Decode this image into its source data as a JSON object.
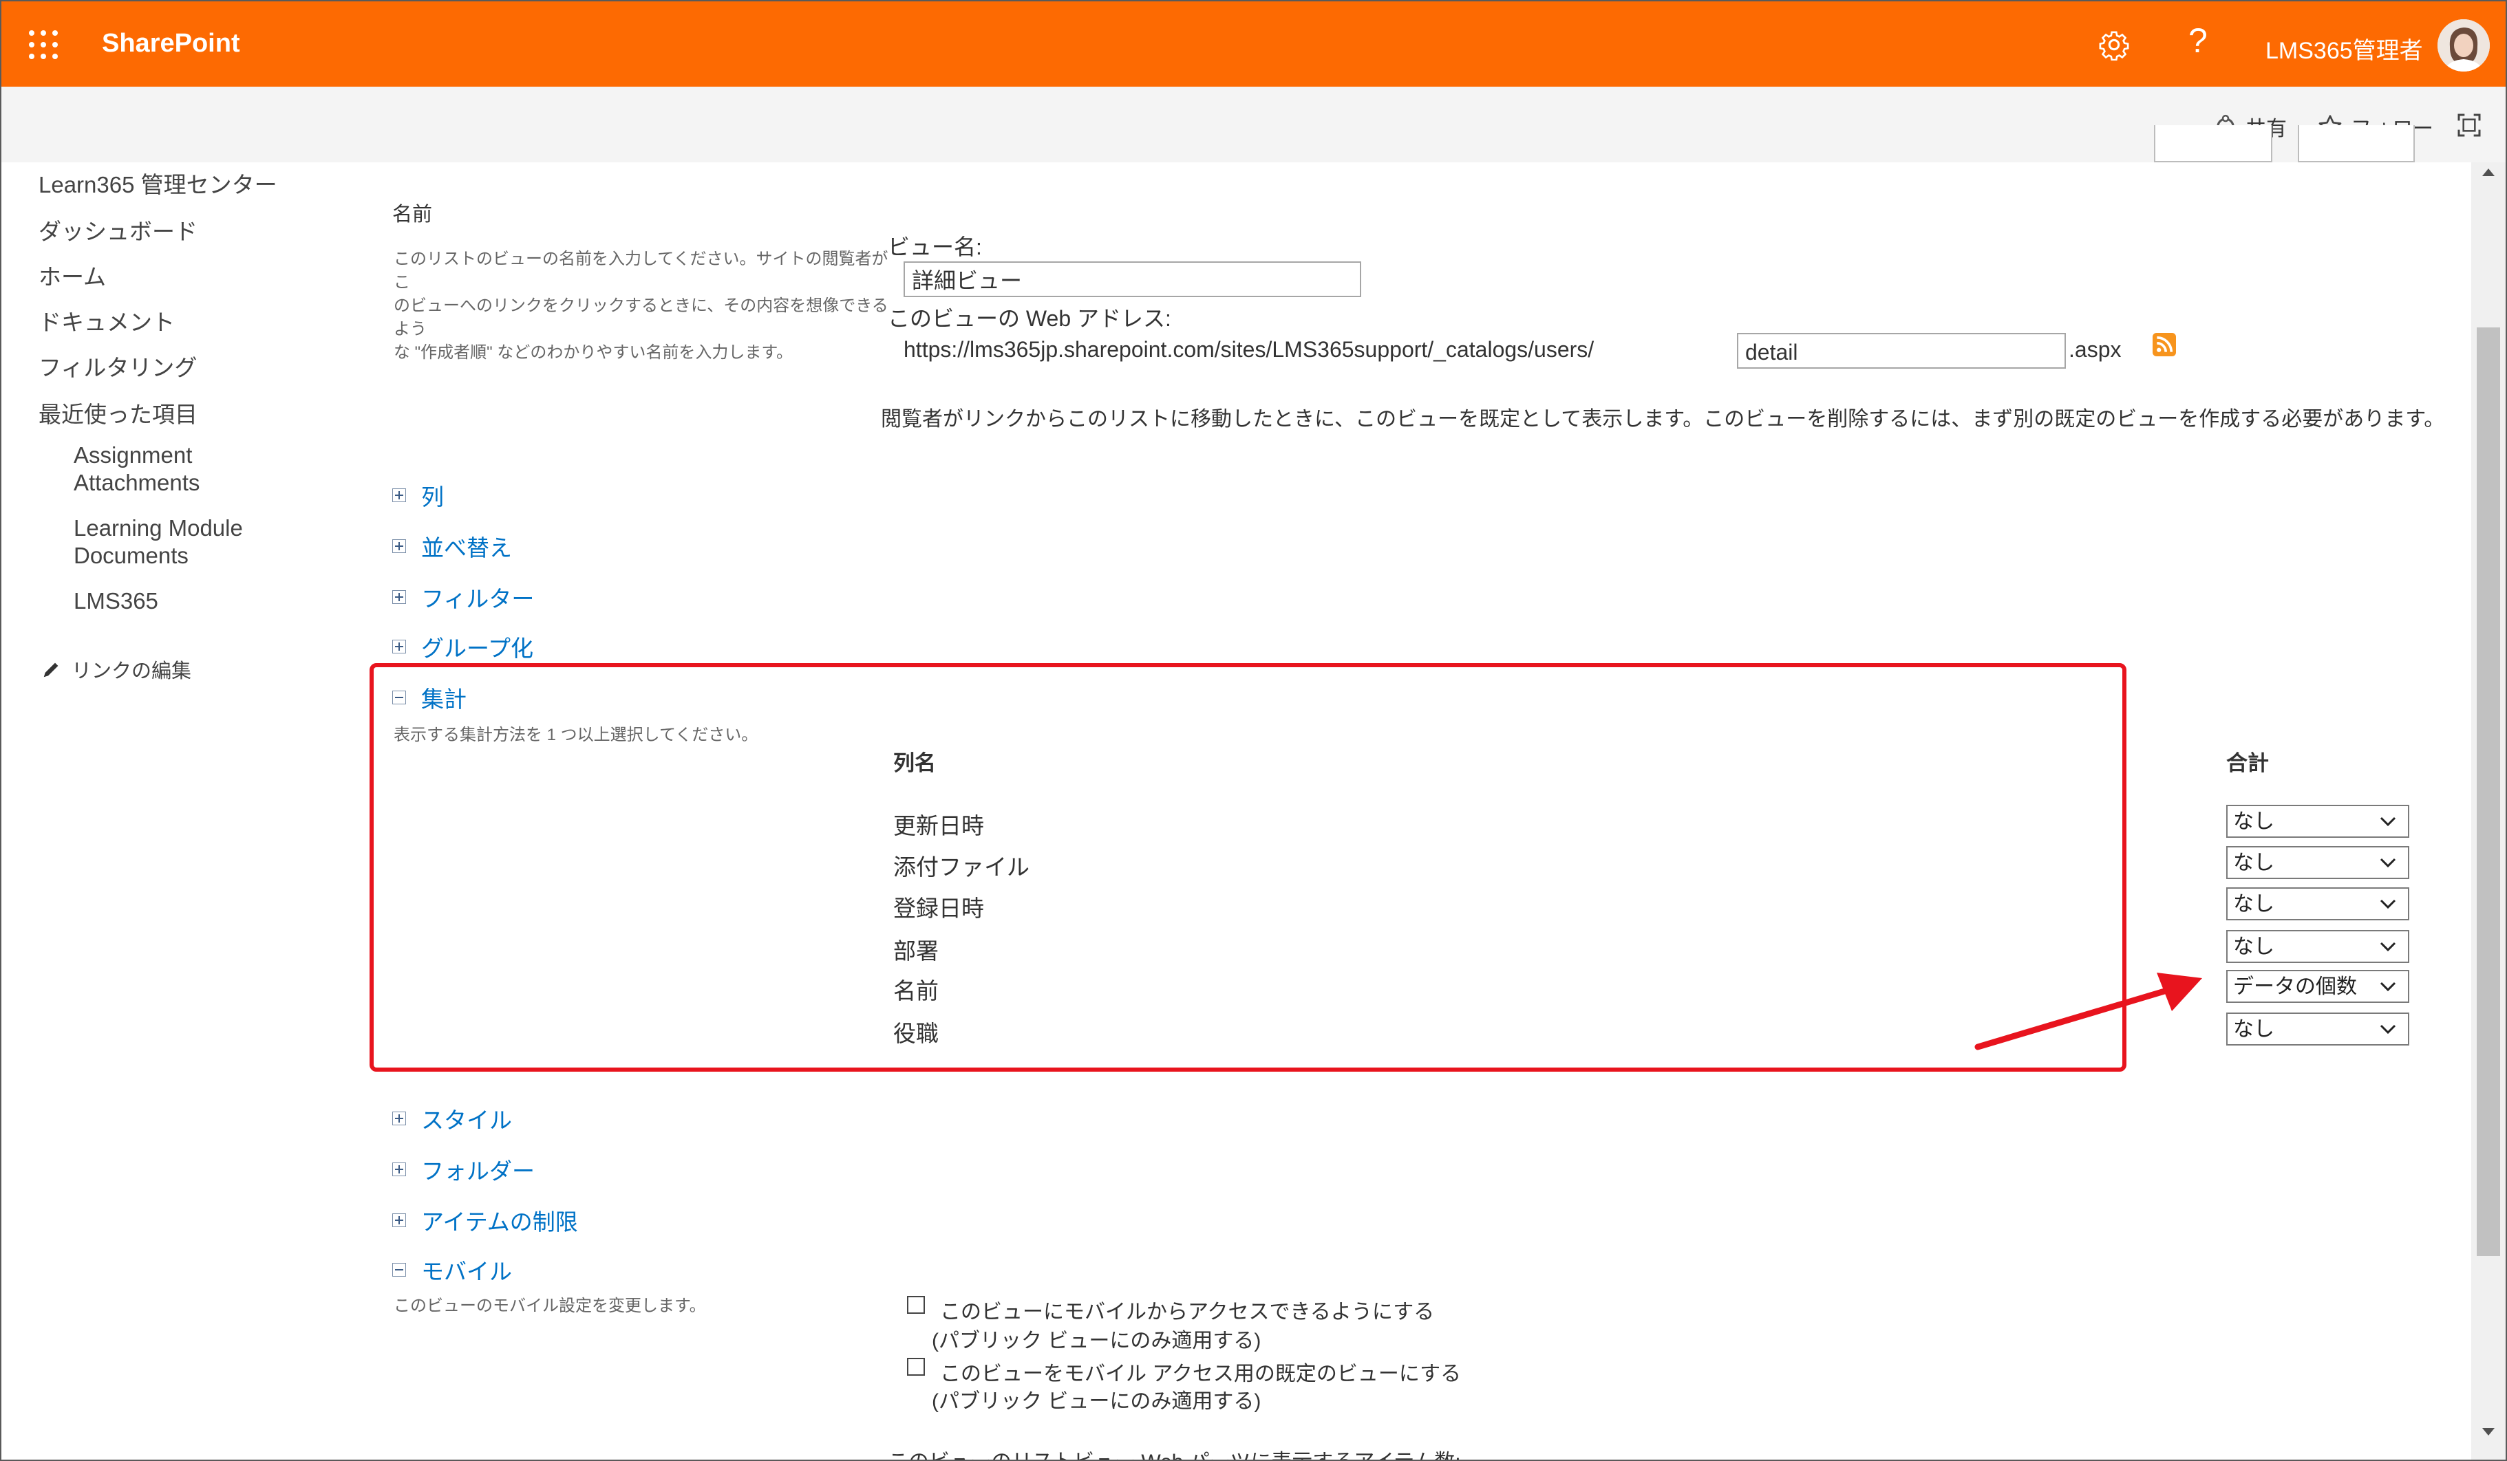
{
  "suite": {
    "brand": "SharePoint",
    "help": "?",
    "user_name": "LMS365管理者"
  },
  "commands": {
    "share": "共有",
    "follow": "フォロー"
  },
  "nav": {
    "title": "Learn365 管理センター",
    "items": [
      "ダッシュボード",
      "ホーム",
      "ドキュメント",
      "フィルタリング",
      "最近使った項目"
    ],
    "recent": [
      {
        "line1": "Assignment",
        "line2": "Attachments"
      },
      {
        "line1": "Learning Module",
        "line2": "Documents"
      },
      {
        "line1": "LMS365",
        "line2": ""
      }
    ],
    "edit_links": "リンクの編集"
  },
  "name_section": {
    "heading": "名前",
    "desc_lines": [
      "このリストのビューの名前を入力してください。サイトの閲覧者がこ",
      "のビューへのリンクをクリックするときに、その内容を想像できるよう",
      "な \"作成者順\" などのわかりやすい名前を入力します。"
    ],
    "view_name_label": "ビュー名:",
    "view_name_value": "詳細ビュー",
    "web_address_label": "このビューの Web アドレス:",
    "url_prefix": "https://lms365jp.sharepoint.com/sites/LMS365support/_catalogs/users/",
    "url_value": "detail",
    "url_suffix": ".aspx",
    "default_note": "閲覧者がリンクからこのリストに移動したときに、このビューを既定として表示します。このビューを削除するには、まず別の既定のビューを作成する必要があります。"
  },
  "sections": {
    "columns": "列",
    "sort": "並べ替え",
    "filter": "フィルター",
    "group": "グループ化",
    "totals": "集計",
    "style": "スタイル",
    "folders": "フォルダー",
    "limit": "アイテムの制限",
    "mobile": "モバイル"
  },
  "totals": {
    "desc": "表示する集計方法を 1 つ以上選択してください。",
    "col_header": "列名",
    "total_header": "合計",
    "rows": [
      {
        "name": "更新日時",
        "value": "なし"
      },
      {
        "name": "添付ファイル",
        "value": "なし"
      },
      {
        "name": "登録日時",
        "value": "なし"
      },
      {
        "name": "部署",
        "value": "なし"
      },
      {
        "name": "名前",
        "value": "データの個数"
      },
      {
        "name": "役職",
        "value": "なし"
      }
    ]
  },
  "mobile": {
    "desc": "このビューのモバイル設定を変更します。",
    "option1": "このビューにモバイルからアクセスできるようにする",
    "option1_note": "(パブリック ビューにのみ適用する)",
    "option2": "このビューをモバイル アクセス用の既定のビューにする",
    "option2_note": "(パブリック ビューにのみ適用する)",
    "cutoff": "このビューのリストビュー Web パーツに表示するアイテム数:"
  },
  "colors": {
    "suite_bar": "#fd6a02",
    "link": "#0072c6",
    "highlight": "#e8141e"
  }
}
